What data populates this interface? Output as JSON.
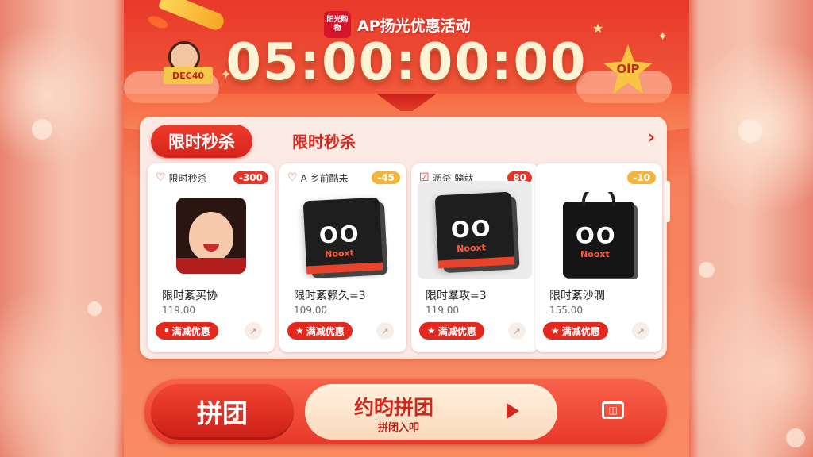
{
  "header": {
    "logo_text": "阳光购物",
    "title": "AP扬光优惠活动",
    "countdown": "05:00:00:00",
    "mascot_sign": "DEC40",
    "star_badge": "OlP"
  },
  "section": {
    "tab_label": "限时秒杀",
    "subtitle": "限时秒杀",
    "more_icon": "chevron-right-icon"
  },
  "products": [
    {
      "tag": "限时秒杀",
      "badge": "-300",
      "image": "portrait",
      "name": "限时紊买协",
      "price": "119.00",
      "promo": "满减优惠"
    },
    {
      "tag": "A 乡前酷未",
      "badge": "-45",
      "image": "black-box",
      "name": "限时紊赖久=3",
      "price": "109.00",
      "promo": "满减优惠"
    },
    {
      "tag": "沥杀 髓就",
      "badge": "80",
      "image": "black-box-grey",
      "name": "限时羣攻=3",
      "price": "119.00",
      "promo": "满减优惠"
    },
    {
      "tag": "",
      "badge": "-10",
      "image": "black-bag",
      "name": "限时紊沙潤",
      "price": "155.00",
      "promo": "满减优惠"
    }
  ],
  "product_box": {
    "eyes": "OO",
    "brand": "Nooxt"
  },
  "bottom": {
    "group_label": "拼团",
    "main_title": "约昀拼团",
    "main_sub": "拼闭入叩",
    "right_icon": "gift-icon"
  },
  "colors": {
    "primary": "#e8382a",
    "accent": "#f9c441",
    "card_bg": "#fbe9e4"
  }
}
